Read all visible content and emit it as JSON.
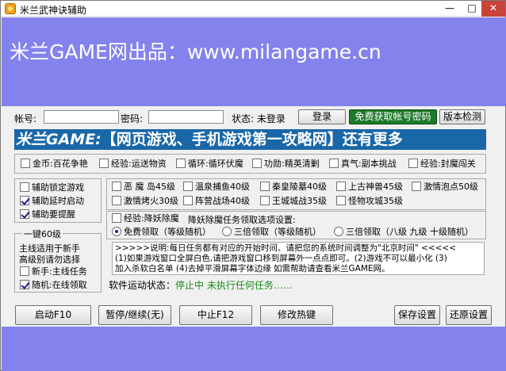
{
  "window": {
    "title": "米兰武神诀辅助",
    "min": "—",
    "max": "□",
    "close": "✕"
  },
  "banner": {
    "text": "米兰GAME网出品：www.milangame.cn"
  },
  "login": {
    "account_label": "帐号:",
    "account_value": "",
    "password_label": "密码:",
    "password_value": "",
    "status_label": "状态: 未登录",
    "login_button": "登录",
    "free_button": "免费获取帐号密码",
    "version_button": "版本检测"
  },
  "ad": {
    "brand": "米兰GAME:",
    "text": "【网页游戏、手机游戏第一攻略网】还有更多"
  },
  "activities": [
    {
      "label": "金币:百花争艳",
      "checked": false
    },
    {
      "label": "经验:运送物资",
      "checked": false
    },
    {
      "label": "循环:循环伏魔",
      "checked": false
    },
    {
      "label": "功勋:精英清剿",
      "checked": false
    },
    {
      "label": "真气:副本挑战",
      "checked": false
    },
    {
      "label": "经验:封魔闯关",
      "checked": false
    }
  ],
  "options": [
    {
      "label": "辅助锁定游戏",
      "checked": false
    },
    {
      "label": "辅助延时启动",
      "checked": true
    },
    {
      "label": "辅助要提醒",
      "checked": true
    }
  ],
  "onekey": {
    "title": "一键60级",
    "desc1": "主线适用于新手",
    "desc2": "高级别请勿选择",
    "newbie": {
      "label": "新手:主线任务",
      "checked": false
    },
    "random": {
      "label": "随机:在线领取",
      "checked": true
    }
  },
  "dungeons": [
    {
      "label": "恶 魔 岛45级",
      "checked": false
    },
    {
      "label": "温泉捕鱼40级",
      "checked": false
    },
    {
      "label": "秦皇陵墓40级",
      "checked": false
    },
    {
      "label": "上古神兽45级",
      "checked": false
    },
    {
      "label": "激情泡点50级",
      "checked": false
    },
    {
      "label": "激情烤火30级",
      "checked": false
    },
    {
      "label": "阵营战场40级",
      "checked": false
    },
    {
      "label": "王城城战35级",
      "checked": false
    },
    {
      "label": "怪物攻城35级",
      "checked": false
    }
  ],
  "demon": {
    "check": {
      "label": "经验:降妖除魔",
      "checked": false
    },
    "setting_label": "降妖除魔任务领取选项设置:",
    "radios": [
      {
        "label": "免费领取（等级随机）",
        "checked": true
      },
      {
        "label": "三倍领取（等级随机）",
        "checked": false
      },
      {
        "label": "三倍领取（八级 九级 十级随机）",
        "checked": false
      }
    ]
  },
  "notice": {
    "line1": ">>>>>说明:每日任务都有对应的开始时间、请把您的系统时间调整为\"北京时间\" <<<<<",
    "line2": "(1)如果游戏窗口全屏白色,请把游戏窗口移到屏幕外一点点即可。(2)游戏不可以最小化 (3)",
    "line3": "加入杀软白名单 (4)去掉平滑屏幕字体边缘 如需帮助请查看米兰GAME网。"
  },
  "status": {
    "label": "软件运动状态：",
    "value": "停止中 未执行任何任务……"
  },
  "buttons": {
    "start": "启动F10",
    "pause": "暂停/继续(无)",
    "stop": "中止F12",
    "hotkey": "修改热键",
    "save": "保存设置",
    "restore": "还原设置"
  },
  "colors": {
    "banner": "#8482ec",
    "ad_bar": "#1a67a8",
    "status_value": "#1a8a1a",
    "free_button": "#1d7a2a"
  }
}
